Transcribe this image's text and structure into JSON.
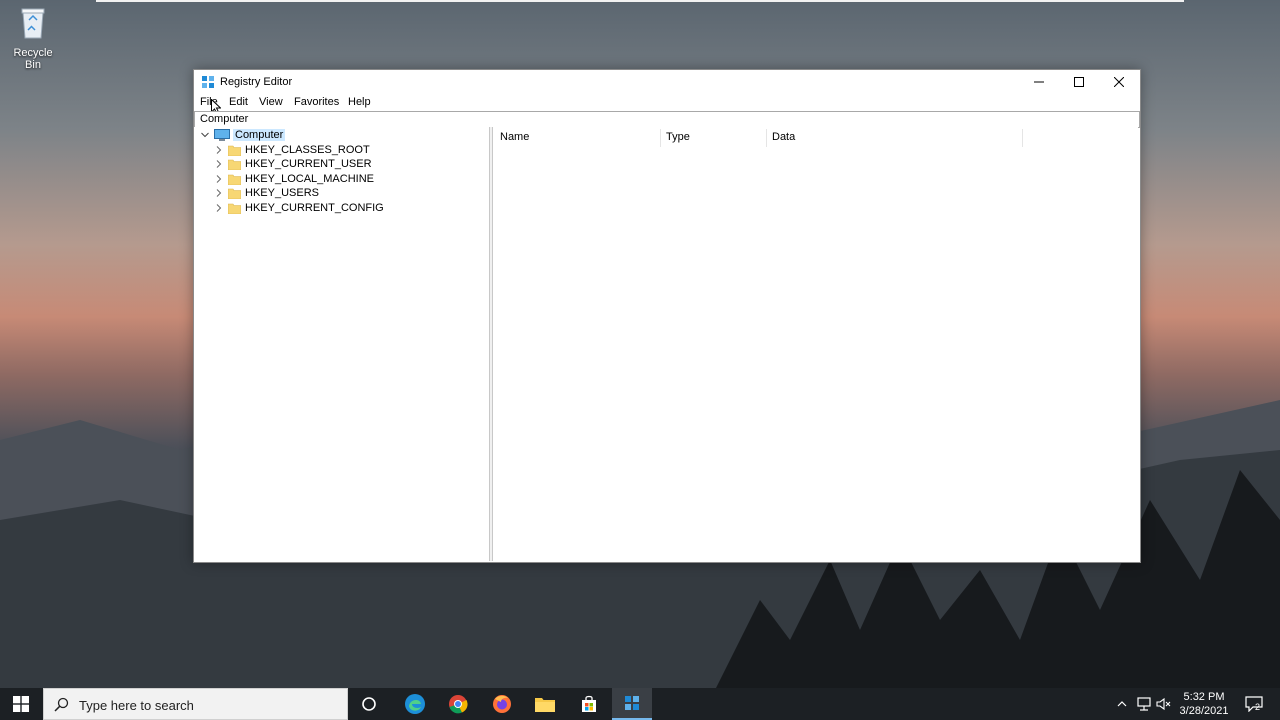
{
  "desktop": {
    "recycle_bin_label": "Recycle Bin"
  },
  "window": {
    "title": "Registry Editor",
    "menu": [
      "File",
      "Edit",
      "View",
      "Favorites",
      "Help"
    ],
    "address": "Computer",
    "tree": {
      "root": "Computer",
      "children": [
        "HKEY_CLASSES_ROOT",
        "HKEY_CURRENT_USER",
        "HKEY_LOCAL_MACHINE",
        "HKEY_USERS",
        "HKEY_CURRENT_CONFIG"
      ]
    },
    "columns": [
      "Name",
      "Type",
      "Data"
    ]
  },
  "taskbar": {
    "search_placeholder": "Type here to search",
    "time": "5:32 PM",
    "date": "3/28/2021",
    "notification_count": "2"
  },
  "colors": {
    "selection": "#cce8ff",
    "taskbar": "#1c2024",
    "accent": "#76b9ed"
  }
}
